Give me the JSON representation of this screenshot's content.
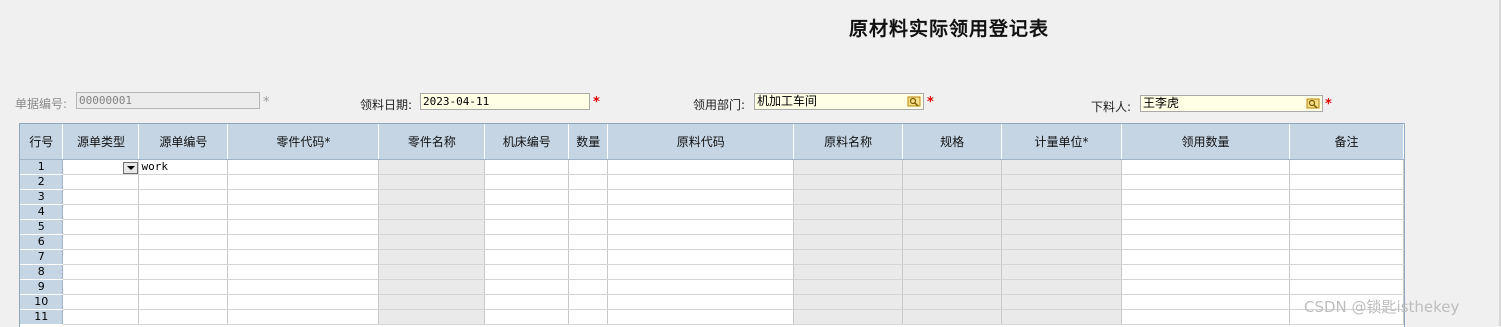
{
  "title": "原材料实际领用登记表",
  "form": {
    "doc_no_label": "单据编号:",
    "doc_no_value": "00000001",
    "doc_no_marker": "*",
    "date_label": "领料日期:",
    "date_value": "2023-04-11",
    "dept_label": "领用部门:",
    "dept_value": "机加工车间",
    "person_label": "下料人:",
    "person_value": "王李虎",
    "required_marker": "*"
  },
  "grid": {
    "columns": [
      "行号",
      "源单类型",
      "源单编号",
      "零件代码*",
      "零件名称",
      "机床编号",
      "数量",
      "原料代码",
      "原料名称",
      "规格",
      "计量单位*",
      "领用数量",
      "备注"
    ],
    "readonly_columns": [
      "零件名称",
      "原料名称",
      "规格",
      "计量单位*"
    ],
    "rows": [
      {
        "no": "1",
        "source_no": "work"
      },
      {
        "no": "2",
        "source_no": ""
      },
      {
        "no": "3",
        "source_no": ""
      },
      {
        "no": "4",
        "source_no": ""
      },
      {
        "no": "5",
        "source_no": ""
      },
      {
        "no": "6",
        "source_no": ""
      },
      {
        "no": "7",
        "source_no": ""
      },
      {
        "no": "8",
        "source_no": ""
      },
      {
        "no": "9",
        "source_no": ""
      },
      {
        "no": "10",
        "source_no": ""
      },
      {
        "no": "11",
        "source_no": ""
      }
    ]
  },
  "watermark": "CSDN @锁匙isthekey",
  "colors": {
    "header_bg": "#c5d5e4",
    "input_bg": "#ffffe6",
    "required": "#e00000"
  }
}
